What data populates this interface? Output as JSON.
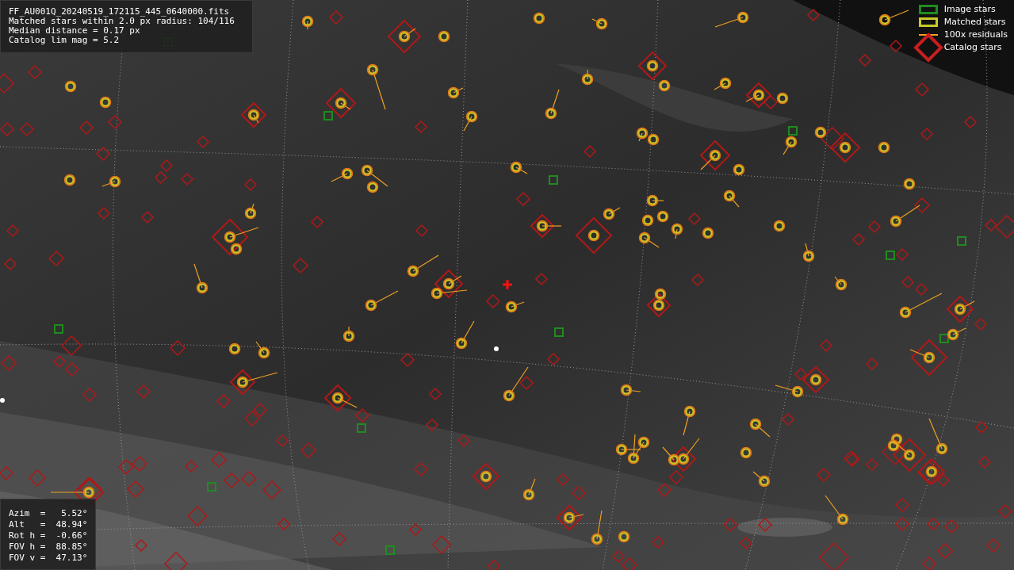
{
  "info_box": {
    "lines": [
      "FF_AU001Q_20240519_172115_445_0640000.fits",
      "Matched stars within 2.0 px radius: 104/116",
      "Median distance = 0.17 px",
      "Catalog lim mag = 5.2"
    ]
  },
  "legend": [
    {
      "label": "Image stars",
      "color": "#1e8c1e"
    },
    {
      "kind": "matched",
      "label": "Matched stars",
      "color": "#c8c828"
    },
    {
      "kind": "residual",
      "label": "100x residuals",
      "color": "#f0a020"
    },
    {
      "kind": "catalog",
      "label": "Catalog stars",
      "color": "#c81e1e"
    }
  ],
  "pointing_box": {
    "lines": [
      "Azim  =   5.52°",
      "Alt   =  48.94°",
      "Rot h =  -0.66°",
      "FOV h =  88.85°",
      "FOV v =  47.13°"
    ]
  }
}
